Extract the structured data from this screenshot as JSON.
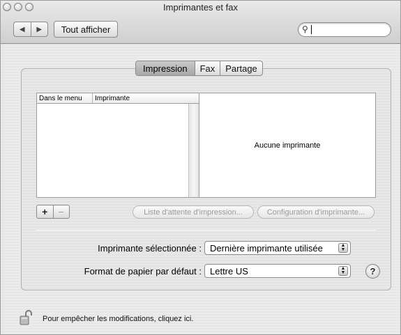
{
  "window": {
    "title": "Imprimantes et fax"
  },
  "toolbar": {
    "back_icon": "triangle-left-icon",
    "forward_icon": "triangle-right-icon",
    "show_all_label": "Tout afficher",
    "search_icon": "magnifier-icon",
    "search_value": ""
  },
  "tabs": [
    {
      "label": "Impression",
      "selected": true
    },
    {
      "label": "Fax",
      "selected": false
    },
    {
      "label": "Partage",
      "selected": false
    }
  ],
  "printer_list": {
    "columns": [
      "Dans le menu",
      "Imprimante"
    ],
    "rows": []
  },
  "detail": {
    "empty_text": "Aucune imprimante"
  },
  "list_controls": {
    "add_label": "+",
    "remove_label": "−"
  },
  "buttons": {
    "print_queue": "Liste d'attente d'impression...",
    "printer_setup": "Configuration d'imprimante..."
  },
  "settings": {
    "selected_printer_label": "Imprimante sélectionnée :",
    "selected_printer_value": "Dernière imprimante utilisée",
    "paper_size_label": "Format de papier par défaut :",
    "paper_size_value": "Lettre US"
  },
  "help_label": "?",
  "lock": {
    "icon": "lock-open-icon",
    "text": "Pour empêcher les modifications, cliquez ici."
  }
}
